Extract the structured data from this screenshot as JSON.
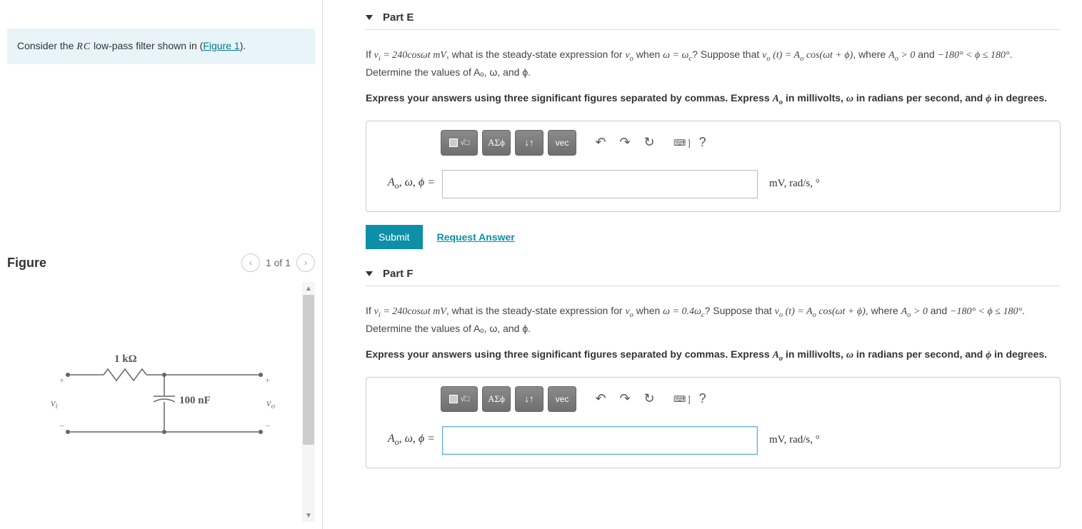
{
  "intro": {
    "prefix": "Consider the ",
    "rc": "RC",
    "mid": " low-pass filter shown in (",
    "link": "Figure 1",
    "suffix": ")."
  },
  "figure": {
    "title": "Figure",
    "counter": "1 of 1",
    "labels": {
      "resistor": "1 kΩ",
      "capacitor": "100 nF",
      "vin": "vᵢ",
      "vout": "vₒ"
    }
  },
  "partE": {
    "title": "Part E",
    "q_prefix": "If ",
    "q_vi": "vᵢ = 240cosωt mV",
    "q_mid1": ", what is the steady-state expression for ",
    "q_vo": "vₒ",
    "q_mid2": " when ",
    "q_cond": "ω = ω_c",
    "q_mid3": "? Suppose that ",
    "q_form": "vₒ (t) = Aₒ cos(ωt + ϕ)",
    "q_mid4": ", where ",
    "q_range": "Aₒ > 0 and −180° < ϕ ≤ 180°",
    "q_end": ". Determine the values of Aₒ, ω, and ϕ.",
    "instr_a": "Express your answers using three significant figures separated by commas. Express ",
    "instr_b": " in millivolts, ",
    "instr_c": " in radians per second, and ",
    "instr_d": " in degrees.",
    "answer_label": "Aₒ, ω, ϕ =",
    "answer_units": "mV, rad/s, °"
  },
  "partF": {
    "title": "Part F",
    "q_prefix": "If ",
    "q_vi": "vᵢ = 240cosωt mV",
    "q_mid1": ", what is the steady-state expression for ",
    "q_vo": "vₒ",
    "q_mid2": " when ",
    "q_cond": "ω = 0.4ω_c",
    "q_mid3": "? Suppose that ",
    "q_form": "vₒ (t) = Aₒ cos(ωt + ϕ)",
    "q_mid4": ", where ",
    "q_range": "Aₒ > 0 and −180° < ϕ ≤ 180°",
    "q_end": ". Determine the values of Aₒ, ω, and ϕ.",
    "instr_a": "Express your answers using three significant figures separated by commas. Express ",
    "instr_b": " in millivolts, ",
    "instr_c": " in radians per second, and ",
    "instr_d": " in degrees.",
    "answer_label": "Aₒ, ω, ϕ =",
    "answer_units": "mV, rad/s, °"
  },
  "toolbar": {
    "greek": "ΑΣϕ",
    "vec": "vec",
    "help": "?"
  },
  "buttons": {
    "submit": "Submit",
    "request": "Request Answer"
  },
  "circuit_values": {
    "R": "1 kΩ",
    "C": "100 nF"
  }
}
